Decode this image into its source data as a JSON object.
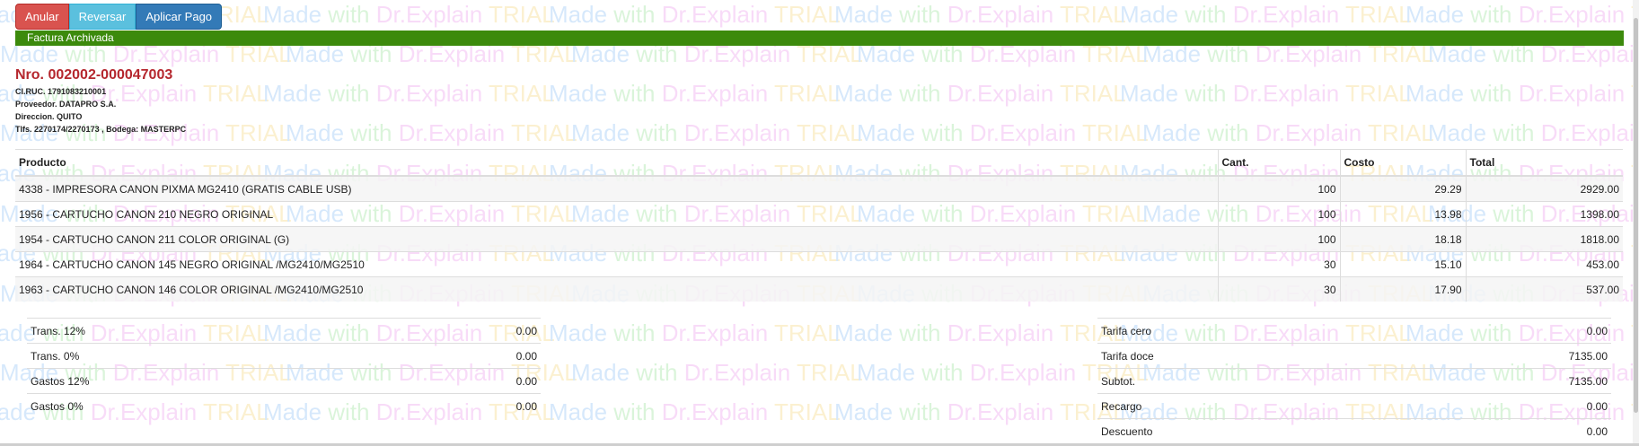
{
  "toolbar": {
    "anular": "Anular",
    "reversar": "Reversar",
    "aplicar_pago": "Aplicar Pago"
  },
  "status": "Factura Archivada",
  "invoice": {
    "number": "Nro. 002002-000047003",
    "ruc": "CI.RUC. 1791083210001",
    "proveedor": "Proveedor. DATAPRO S.A.",
    "direccion": "Direccion. QUITO",
    "telefonos": "Tlfs. 2270174/2270173 , Bodega: MASTERPC"
  },
  "table": {
    "headers": {
      "producto": "Producto",
      "cant": "Cant.",
      "costo": "Costo",
      "total": "Total"
    },
    "rows": [
      {
        "producto": "4338 - IMPRESORA CANON PIXMA MG2410 (GRATIS CABLE USB)",
        "cant": "100",
        "costo": "29.29",
        "total": "2929.00"
      },
      {
        "producto": "1956 - CARTUCHO CANON 210 NEGRO ORIGINAL",
        "cant": "100",
        "costo": "13.98",
        "total": "1398.00"
      },
      {
        "producto": "1954 - CARTUCHO CANON 211 COLOR ORIGINAL (G)",
        "cant": "100",
        "costo": "18.18",
        "total": "1818.00"
      },
      {
        "producto": "1964 - CARTUCHO CANON 145 NEGRO ORIGINAL /MG2410/MG2510",
        "cant": "30",
        "costo": "15.10",
        "total": "453.00"
      },
      {
        "producto": "1963 - CARTUCHO CANON 146 COLOR ORIGINAL /MG2410/MG2510",
        "cant": "30",
        "costo": "17.90",
        "total": "537.00"
      }
    ]
  },
  "totals_left": [
    {
      "label": "Trans. 12%",
      "value": "0.00"
    },
    {
      "label": "Trans. 0%",
      "value": "0.00"
    },
    {
      "label": "Gastos 12%",
      "value": "0.00"
    },
    {
      "label": "Gastos 0%",
      "value": "0.00"
    }
  ],
  "totals_right": [
    {
      "label": "Tarifa cero",
      "value": "0.00"
    },
    {
      "label": "Tarifa doce",
      "value": "7135.00"
    },
    {
      "label": "Subtot.",
      "value": "7135.00"
    },
    {
      "label": "Recargo",
      "value": "0.00"
    },
    {
      "label": "Descuento",
      "value": "0.00"
    }
  ],
  "watermark": {
    "made": "Made",
    "with": "with",
    "dr": "Dr.",
    "explain": "Explain",
    "trial": "TRIAL"
  },
  "colors": {
    "status_green": "#3c8a0c",
    "invoice_red": "#b5272e",
    "btn_danger": "#d9534f",
    "btn_info": "#5bc0de",
    "btn_primary": "#337ab7"
  }
}
